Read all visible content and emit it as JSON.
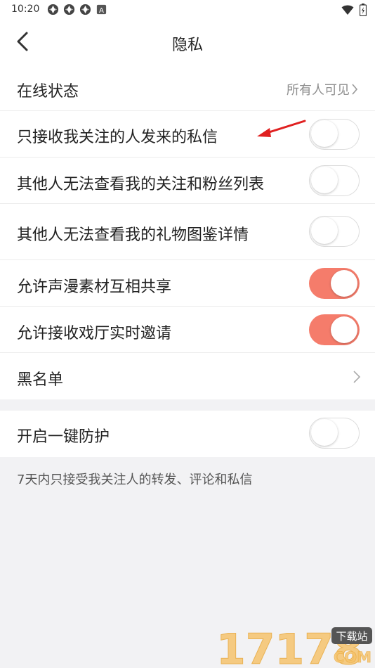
{
  "status_bar": {
    "time": "10:20",
    "notification_icons": [
      "app-icon",
      "app-icon",
      "app-icon",
      "a-badge-icon"
    ],
    "a_badge": "A"
  },
  "header": {
    "title": "隐私",
    "back_icon": "chevron-left-icon"
  },
  "settings": {
    "online_status": {
      "label": "在线状态",
      "value": "所有人可见"
    },
    "rows": [
      {
        "label": "只接收我关注的人发来的私信",
        "on": false
      },
      {
        "label": "其他人无法查看我的关注和粉丝列表",
        "on": false
      },
      {
        "label": "其他人无法查看我的礼物图鉴详情",
        "on": false
      },
      {
        "label": "允许声漫素材互相共享",
        "on": true
      },
      {
        "label": "允许接收戏厅实时邀请",
        "on": true
      }
    ],
    "blacklist": {
      "label": "黑名单"
    }
  },
  "protection": {
    "label": "开启一键防护",
    "on": false,
    "note": "7天内只接受我关注人的转发、评论和私信"
  },
  "watermark": {
    "number": "17178",
    "tag": "下载站",
    "domain": "COM"
  },
  "colors": {
    "accent": "#f57c6b",
    "annotation_arrow": "#e02020",
    "background": "#f2f2f4"
  }
}
